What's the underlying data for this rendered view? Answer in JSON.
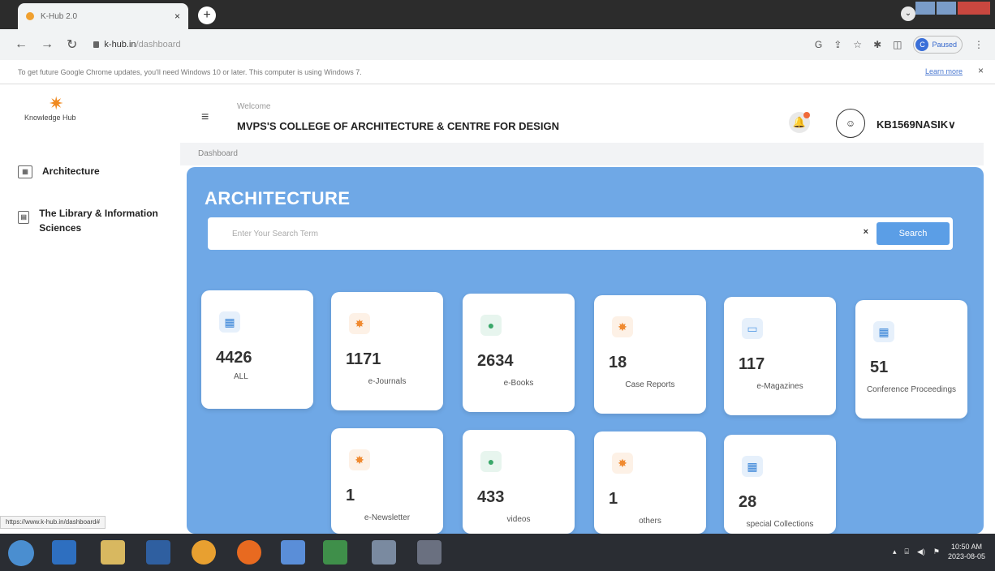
{
  "browser": {
    "tab_title": "K-Hub 2.0",
    "tab_close": "×",
    "new_tab": "+",
    "url_domain": "k-hub.in",
    "url_path": "/dashboard",
    "profile_initial": "C",
    "profile_status": "Paused",
    "infobar_text": "To get future Google Chrome updates, you'll need Windows 10 or later. This computer is using Windows 7.",
    "learn_more": "Learn more",
    "infobar_close": "×",
    "status_url": "https://www.k-hub.in/dashboard#"
  },
  "sidebar": {
    "logo_text": "Knowledge Hub",
    "items": [
      {
        "label": "Architecture"
      },
      {
        "label": "The Library & Information Sciences"
      }
    ]
  },
  "header": {
    "welcome": "Welcome",
    "college": "MVPS'S COLLEGE OF ARCHITECTURE & CENTRE FOR DESIGN",
    "username": "KB1569NASIK",
    "username_caret": "∨"
  },
  "breadcrumb": "Dashboard",
  "main": {
    "title": "ARCHITECTURE",
    "search_placeholder": "Enter Your Search Term",
    "search_clear": "×",
    "search_button": "Search",
    "cards": [
      {
        "count": "4426",
        "label": "ALL",
        "icon": "grid-icon"
      },
      {
        "count": "1171",
        "label": "e-Journals",
        "icon": "bulb-icon"
      },
      {
        "count": "2634",
        "label": "e-Books",
        "icon": "person-icon"
      },
      {
        "count": "18",
        "label": "Case Reports",
        "icon": "bulb-icon"
      },
      {
        "count": "117",
        "label": "e-Magazines",
        "icon": "book-icon"
      },
      {
        "count": "51",
        "label": "Conference Proceedings",
        "icon": "grid-icon"
      },
      {
        "count": "1",
        "label": "e-Newsletter",
        "icon": "bulb-icon"
      },
      {
        "count": "433",
        "label": "videos",
        "icon": "person-icon"
      },
      {
        "count": "1",
        "label": "others",
        "icon": "bulb-icon"
      },
      {
        "count": "28",
        "label": "special Collections",
        "icon": "grid-icon"
      }
    ]
  },
  "taskbar": {
    "time": "10:50 AM",
    "date": "2023-08-05"
  }
}
